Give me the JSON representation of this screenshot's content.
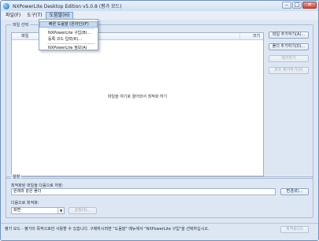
{
  "window": {
    "title": "NXPowerLite Desktop Edition v5.0.8 (평가 모드)",
    "controls": {
      "minimize": "–",
      "maximize": "□",
      "close": "✕"
    }
  },
  "menubar": {
    "items": [
      {
        "label": "파일(F)"
      },
      {
        "label": "도구(T)"
      },
      {
        "label": "도움말(H)"
      }
    ]
  },
  "help_menu": {
    "items": [
      {
        "label": "빠른 도움말 (온라인)(F)"
      },
      {
        "label": "NXPowerLite 구입(B)..."
      },
      {
        "label": "등록 코드 입력(R)..."
      },
      {
        "label": "NXPowerLite 정보(A)"
      }
    ]
  },
  "file_group": {
    "label": "파일 선택",
    "columns": {
      "name": "파일",
      "size": "크기"
    },
    "empty_message": "파일을 여기로 끌어와서 최적화 하기"
  },
  "side_buttons": {
    "add_files": "파일 추가하기(A)...",
    "add_folder": "폴더 추가하기(D)...",
    "remove": "제거하기",
    "remove_all": "모두 제거하기(V)"
  },
  "settings": {
    "label": "설정",
    "save_label": "최적화된 파일을 다음으로 저장:",
    "save_value": "원래와 같은 폴더",
    "change_button": "변경(E)...",
    "optimize_label": "다음으로 최적화:",
    "optimize_value": "화면",
    "optimize_settings_button": "설정(S)..."
  },
  "status": {
    "message": "평가 모드 - 평가의 목적으로만 사용할 수 있습니다. 구매하시려면 \"도움말\" 메뉴에서 \"NXPowerLite 구입\"을 선택하십시오.",
    "optimize_button": "최적화(O)"
  }
}
